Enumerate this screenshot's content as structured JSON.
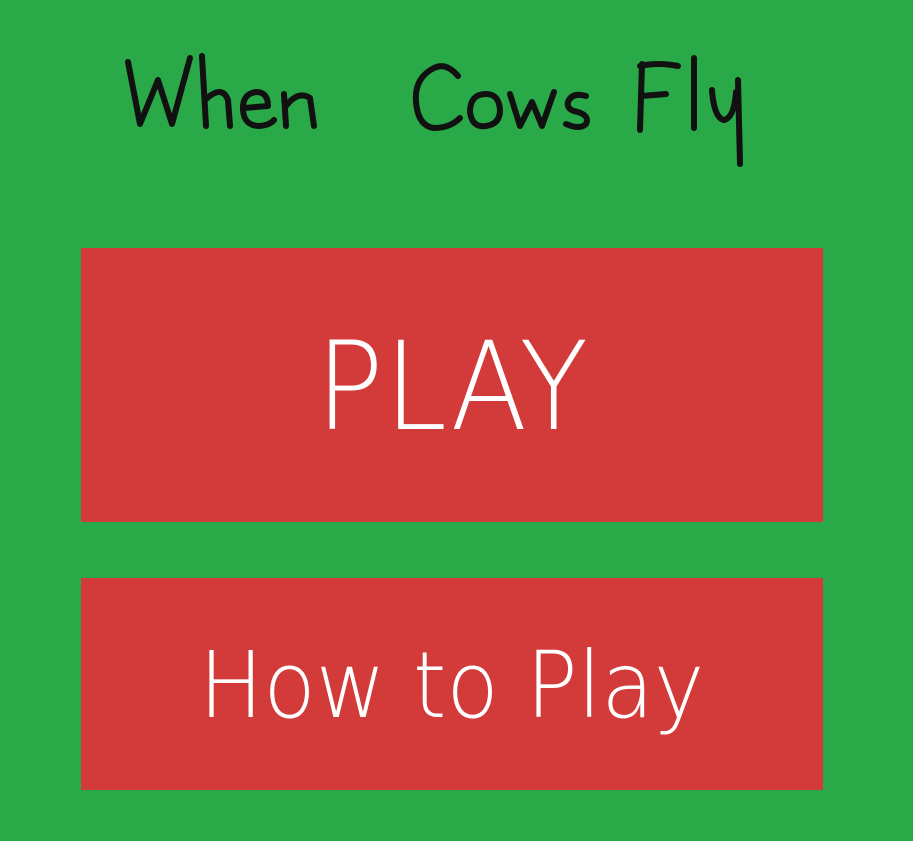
{
  "game": {
    "title": "When Cows Fly"
  },
  "menu": {
    "play_label": "PLAY",
    "how_to_play_label": "How to Play"
  },
  "colors": {
    "background": "#2aa948",
    "button": "#d33b3b",
    "button_text": "#ffffff",
    "title_ink": "#111111"
  }
}
